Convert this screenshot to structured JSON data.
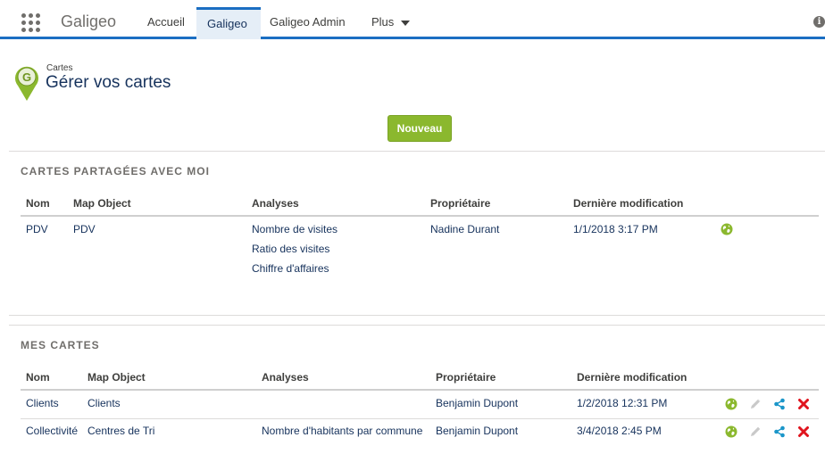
{
  "nav": {
    "app_name": "Galigeo",
    "tabs": [
      {
        "label": "Accueil"
      },
      {
        "label": "Galigeo"
      },
      {
        "label": "Galigeo Admin"
      },
      {
        "label": "Plus"
      }
    ],
    "info_glyph": "i",
    "accent": "#1b6ec2"
  },
  "header": {
    "breadcrumb": "Cartes",
    "title": "Gérer vos cartes",
    "new_button": "Nouveau",
    "brand_color": "#8bb82e"
  },
  "shared": {
    "title": "CARTES PARTAGÉES AVEC MOI",
    "columns": [
      "Nom",
      "Map Object",
      "Analyses",
      "Propriétaire",
      "Dernière modification"
    ],
    "rows": [
      {
        "name": "PDV",
        "map_object": "PDV",
        "analyses": [
          "Nombre de visites",
          "Ratio des visites",
          "Chiffre d'affaires"
        ],
        "owner": "Nadine Durant",
        "modified": "1/1/2018 3:17 PM",
        "actions": [
          "globe-icon"
        ]
      }
    ]
  },
  "mine": {
    "title": "MES CARTES",
    "columns": [
      "Nom",
      "Map Object",
      "Analyses",
      "Propriétaire",
      "Dernière modification"
    ],
    "rows": [
      {
        "name": "Clients",
        "map_object": "Clients",
        "analyses": "",
        "owner": "Benjamin Dupont",
        "modified": "1/2/2018 12:31 PM",
        "actions": [
          "globe-icon",
          "pencil-icon",
          "share-icon",
          "delete-icon"
        ]
      },
      {
        "name": "Collectivité",
        "map_object": "Centres de Tri",
        "analyses": "Nombre d'habitants par commune",
        "owner": "Benjamin Dupont",
        "modified": "3/4/2018 2:45 PM",
        "actions": [
          "globe-icon",
          "pencil-icon",
          "share-icon",
          "delete-icon"
        ]
      }
    ]
  }
}
